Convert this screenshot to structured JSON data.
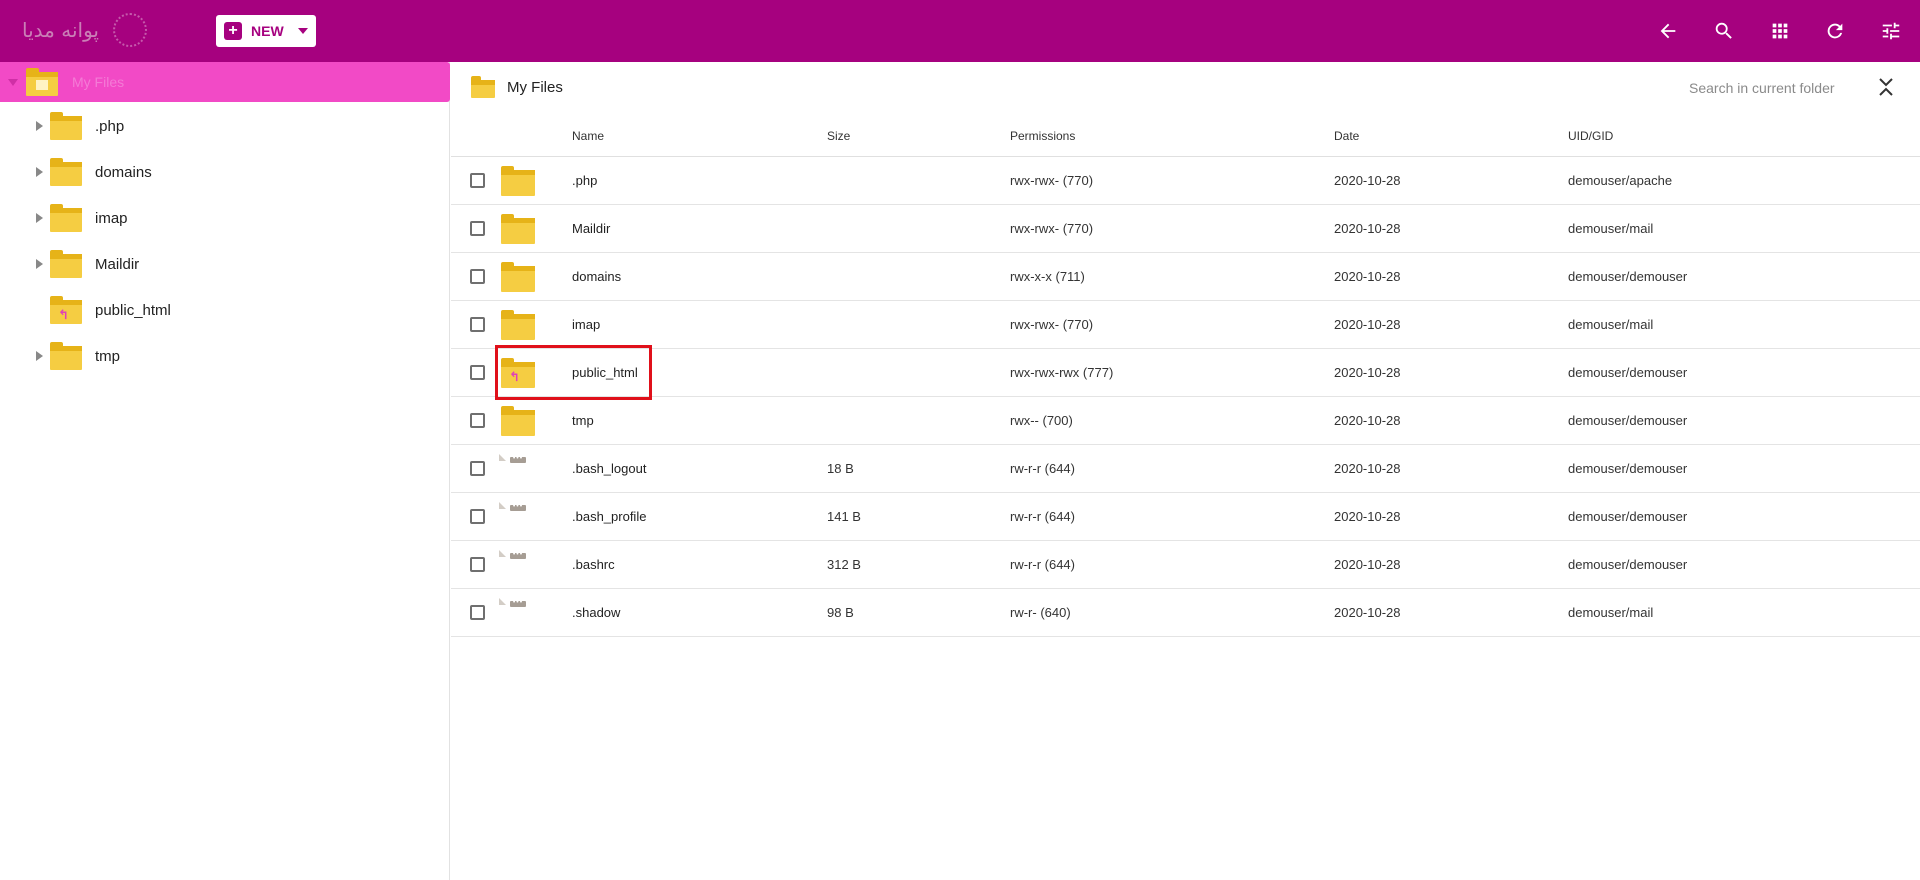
{
  "colors": {
    "topbar": "#a6017f",
    "root_highlight": "#f24ac6",
    "folder": "#f5cd42",
    "annotation": "#e0101a"
  },
  "header": {
    "logo_text": "پوانه مدیا",
    "new_label": "NEW",
    "icons": [
      "back-arrow-icon",
      "search-icon",
      "grid-view-icon",
      "refresh-icon",
      "settings-sliders-icon"
    ]
  },
  "sidebar": {
    "root_label": "My Files",
    "items": [
      {
        "label": ".php",
        "expandable": true,
        "link": false
      },
      {
        "label": "domains",
        "expandable": true,
        "link": false
      },
      {
        "label": "imap",
        "expandable": true,
        "link": false
      },
      {
        "label": "Maildir",
        "expandable": true,
        "link": false
      },
      {
        "label": "public_html",
        "expandable": false,
        "link": true
      },
      {
        "label": "tmp",
        "expandable": true,
        "link": false
      }
    ]
  },
  "main": {
    "breadcrumb": "My Files",
    "search_placeholder": "Search in current folder",
    "columns": {
      "name": "Name",
      "size": "Size",
      "permissions": "Permissions",
      "date": "Date",
      "uid": "UID/GID"
    },
    "rows": [
      {
        "type": "folder",
        "name": ".php",
        "size": "",
        "permissions": "rwx-rwx- (770)",
        "date": "2020-10-28",
        "uid": "demouser/apache"
      },
      {
        "type": "folder",
        "name": "Maildir",
        "size": "",
        "permissions": "rwx-rwx- (770)",
        "date": "2020-10-28",
        "uid": "demouser/mail"
      },
      {
        "type": "folder",
        "name": "domains",
        "size": "",
        "permissions": "rwx-x-x (711)",
        "date": "2020-10-28",
        "uid": "demouser/demouser"
      },
      {
        "type": "folder",
        "name": "imap",
        "size": "",
        "permissions": "rwx-rwx- (770)",
        "date": "2020-10-28",
        "uid": "demouser/mail"
      },
      {
        "type": "link-folder",
        "name": "public_html",
        "size": "",
        "permissions": "rwx-rwx-rwx (777)",
        "date": "2020-10-28",
        "uid": "demouser/demouser",
        "highlighted": true
      },
      {
        "type": "folder",
        "name": "tmp",
        "size": "",
        "permissions": "rwx-- (700)",
        "date": "2020-10-28",
        "uid": "demouser/demouser"
      },
      {
        "type": "file",
        "name": ".bash_logout",
        "size": "18 B",
        "permissions": "rw-r-r (644)",
        "date": "2020-10-28",
        "uid": "demouser/demouser"
      },
      {
        "type": "file",
        "name": ".bash_profile",
        "size": "141 B",
        "permissions": "rw-r-r (644)",
        "date": "2020-10-28",
        "uid": "demouser/demouser"
      },
      {
        "type": "file",
        "name": ".bashrc",
        "size": "312 B",
        "permissions": "rw-r-r (644)",
        "date": "2020-10-28",
        "uid": "demouser/demouser"
      },
      {
        "type": "file",
        "name": ".shadow",
        "size": "98 B",
        "permissions": "rw-r- (640)",
        "date": "2020-10-28",
        "uid": "demouser/mail"
      }
    ]
  }
}
